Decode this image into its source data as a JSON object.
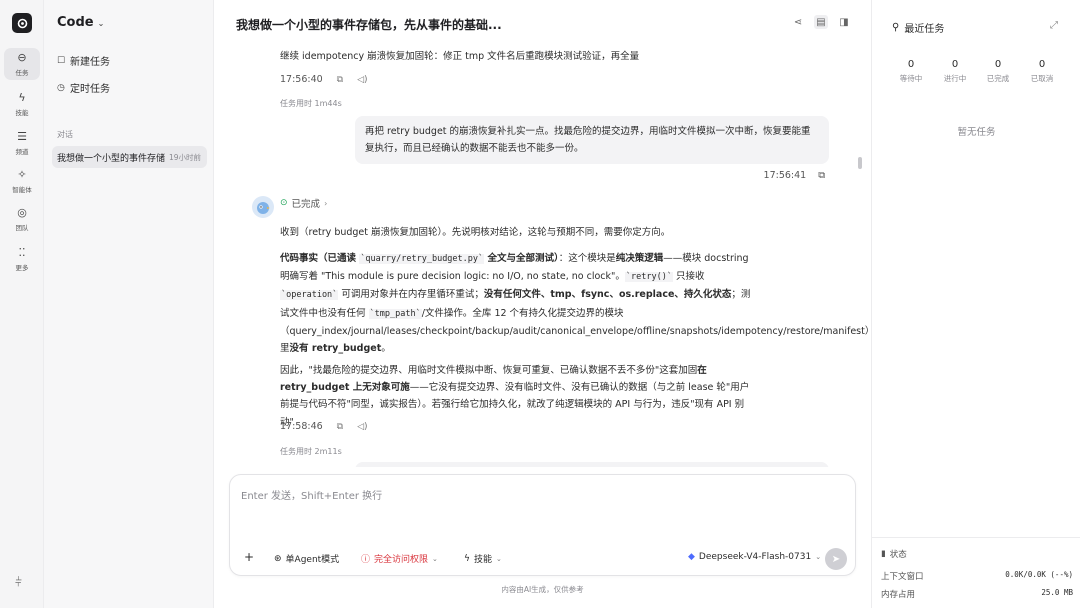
{
  "rail": {
    "items": [
      {
        "label": "任务",
        "icon": "task-icon"
      },
      {
        "label": "技能",
        "icon": "skill-icon"
      },
      {
        "label": "频道",
        "icon": "channel-icon"
      },
      {
        "label": "智能体",
        "icon": "agent-icon"
      },
      {
        "label": "团队",
        "icon": "team-icon"
      },
      {
        "label": "更多",
        "icon": "more-icon"
      }
    ]
  },
  "sidebar": {
    "app_title": "Code",
    "new_task": "新建任务",
    "scheduled_task": "定时任务",
    "section_label": "对话",
    "conversation": {
      "title": "我想做一个小型的事件存储包...",
      "time": "19小时前"
    }
  },
  "main": {
    "title": "我想做一个小型的事件存储包，先从事件的基础...",
    "msg1": {
      "text": "继续 idempotency 崩溃恢复加固轮：修正 tmp 文件名后重跑模块测试验证，再全量",
      "time": "17:56:40",
      "duration": "任务用时 1m44s"
    },
    "user_msg": {
      "text": "再把 retry budget 的崩溃恢复补扎实一点。找最危险的提交边界，用临时文件模拟一次中断，恢复要能重复执行，而且已经确认的数据不能丢也不能多一份。",
      "time": "17:56:41"
    },
    "agent": {
      "status": "已完成",
      "p1": "收到（retry budget 崩溃恢复加固轮）。先说明核对结论，这轮与预期不同，需要你定方向。",
      "p2_a": "代码事实（已通读 ",
      "p2_code1": "`quarry/retry_budget.py`",
      "p2_b": " 全文与全部测试）",
      "p2_c": "：这个模块是",
      "p2_d": "纯决策逻辑",
      "p2_e": "——模块 docstring 明确写着 \"This module is pure decision logic: no I/O, no state, no clock\"。",
      "p2_code2": "`retry()`",
      "p2_f": " 只接收 ",
      "p2_code3": "`operation`",
      "p2_g": " 可调用对象并在内存里循环重试；",
      "p2_h": "没有任何文件、tmp、fsync、os.replace、持久化状态",
      "p2_i": "；测试文件中也没有任何 ",
      "p2_code4": "`tmp_path`",
      "p2_j": "/文件操作。全库 12 个有持久化提交边界的模块（query_index/journal/leases/checkpoint/backup/audit/canonical_envelope/offline/snapshots/idempotency/restore/manifest）里",
      "p2_k": "没有 retry_budget",
      "p2_l": "。",
      "p3_a": "因此，\"找最危险的提交边界、用临时文件模拟中断、恢复可重复、已确认数据不丢不多份\"这套加固",
      "p3_b": "在 retry_budget 上无对象可施",
      "p3_c": "——它没有提交边界、没有临时文件、没有已确认的数据（与之前 lease 轮\"用户前提与代码不符\"同型，诚实报告）。若强行给它加持久化，就改了纯逻辑模块的 API 与行为，违反\"现有 API 别动\"",
      "time": "17:58:46",
      "duration": "任务用时 2m11s"
    }
  },
  "composer": {
    "placeholder": "Enter 发送，Shift+Enter 换行",
    "mode": "单Agent模式",
    "access": "完全访问权限",
    "skills": "技能",
    "model": "Deepseek-V4-Flash-0731",
    "footnote": "内容由AI生成，仅供参考"
  },
  "right_panel": {
    "title": "最近任务",
    "stats": [
      {
        "count": "0",
        "label": "等待中"
      },
      {
        "count": "0",
        "label": "进行中"
      },
      {
        "count": "0",
        "label": "已完成"
      },
      {
        "count": "0",
        "label": "已取消"
      }
    ],
    "empty": "暂无任务",
    "status_label": "状态",
    "context_label": "上下文窗口",
    "context_value": "0.0K/0.0K (--%)",
    "memory_label": "内存占用",
    "memory_value": "25.0 MB"
  },
  "colors": {
    "accent_warn": "#d9363e",
    "success": "#22a55a",
    "logo_bg": "#1f1f22"
  }
}
